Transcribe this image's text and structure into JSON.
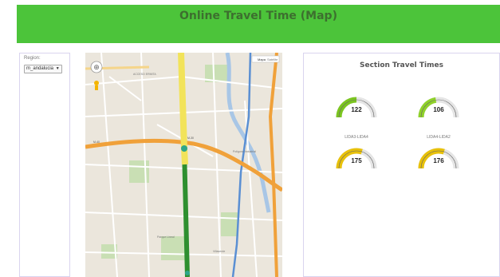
{
  "header": {
    "title": "Online Travel Time (Map)"
  },
  "sidebar": {
    "region_label": "Region:",
    "region_value": "m_andalucia",
    "caret": "▼"
  },
  "map": {
    "zoom_control": "⊕",
    "map_type_labels": [
      "Mapa",
      "Satélite"
    ],
    "labels": [
      "ACCESO ERMITA",
      "M-30",
      "M-40",
      "Polígono Industrial",
      "Parque Lineal",
      "Villaverde"
    ],
    "route_colors": {
      "yellow": "#f2e35a",
      "green": "#2e8f2f",
      "highway": "#f0a13a"
    }
  },
  "panel": {
    "title": "Section Travel Times",
    "gauges": [
      {
        "value": "122",
        "label": "",
        "level": 0.5,
        "color": "#7bc520"
      },
      {
        "value": "106",
        "label": "",
        "level": 0.45,
        "color": "#8fd12a"
      },
      {
        "value": "175",
        "label": "LIDA3-LIDA4",
        "level": 0.6,
        "color": "#e8c10a"
      },
      {
        "value": "176",
        "label": "LIDA4-LIDA2",
        "level": 0.6,
        "color": "#e8c10a"
      }
    ]
  }
}
